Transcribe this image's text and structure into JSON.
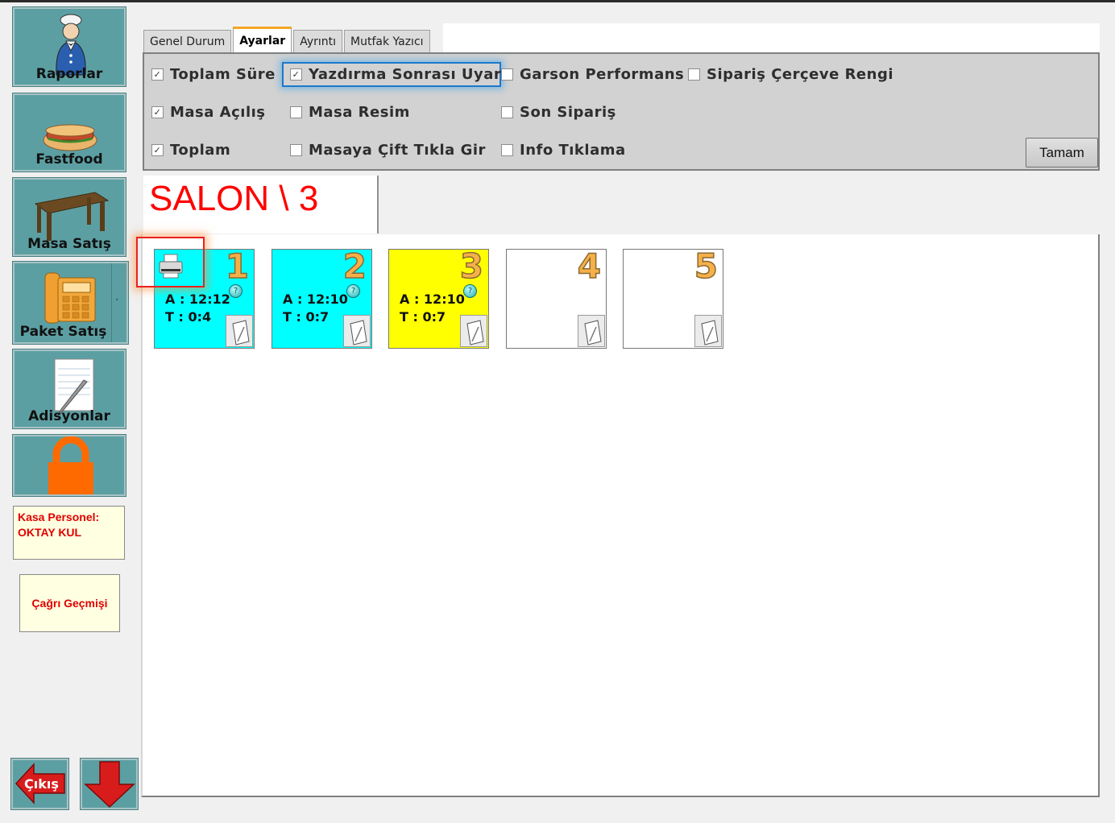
{
  "sidebar": {
    "buttons": [
      {
        "id": "raporlar",
        "label": "Raporlar",
        "icon": "waiter-icon"
      },
      {
        "id": "fastfood",
        "label": "Fastfood",
        "icon": "hotdog-icon"
      },
      {
        "id": "masa",
        "label": "Masa Satış",
        "icon": "table-icon"
      },
      {
        "id": "paket",
        "label": "Paket Satış",
        "icon": "phone-icon"
      },
      {
        "id": "adisyon",
        "label": "Adisyonlar",
        "icon": "notepad-icon"
      },
      {
        "id": "lock",
        "label": "",
        "icon": "lock-icon"
      }
    ],
    "kasa_label": "Kasa Personel:",
    "kasa_name": "OKTAY KUL",
    "call_history": "Çağrı Geçmişi",
    "exit_label": "Çıkış"
  },
  "tabs": [
    {
      "label": "Genel Durum",
      "active": false
    },
    {
      "label": "Ayarlar",
      "active": true
    },
    {
      "label": "Ayrıntı",
      "active": false
    },
    {
      "label": "Mutfak Yazıcı",
      "active": false
    }
  ],
  "settings": {
    "options": [
      {
        "label": "Toplam Süre",
        "checked": true
      },
      {
        "label": "Yazdırma Sonrası Uyarı",
        "checked": true
      },
      {
        "label": "Garson Performans",
        "checked": false
      },
      {
        "label": "Sipariş Çerçeve Rengi",
        "checked": false
      },
      {
        "label": "Masa Açılış",
        "checked": true
      },
      {
        "label": "Masa Resim",
        "checked": false
      },
      {
        "label": "Son Sipariş",
        "checked": false
      },
      {
        "label": "Toplam",
        "checked": true
      },
      {
        "label": "Masaya Çift Tıkla Gir",
        "checked": false
      },
      {
        "label": "Info Tıklama",
        "checked": false
      }
    ],
    "ok_label": "Tamam"
  },
  "salon": {
    "title": "SALON \\ 3"
  },
  "tables": [
    {
      "number": "1",
      "color": "#00ffff",
      "open": "A : 12:12",
      "total": "T : 0:4",
      "occupied": true
    },
    {
      "number": "2",
      "color": "#00ffff",
      "open": "A : 12:10",
      "total": "T : 0:7",
      "occupied": true
    },
    {
      "number": "3",
      "color": "#ffff00",
      "open": "A : 12:10",
      "total": "T : 0:7",
      "occupied": true
    },
    {
      "number": "4",
      "color": "#ffffff",
      "open": "",
      "total": "",
      "occupied": false
    },
    {
      "number": "5",
      "color": "#ffffff",
      "open": "",
      "total": "",
      "occupied": false
    }
  ],
  "colors": {
    "sidebar_button": "#5c9fa3",
    "salon_title": "#ff0000",
    "accent_focus": "#1e78c8",
    "highlight": "#e8221e"
  }
}
